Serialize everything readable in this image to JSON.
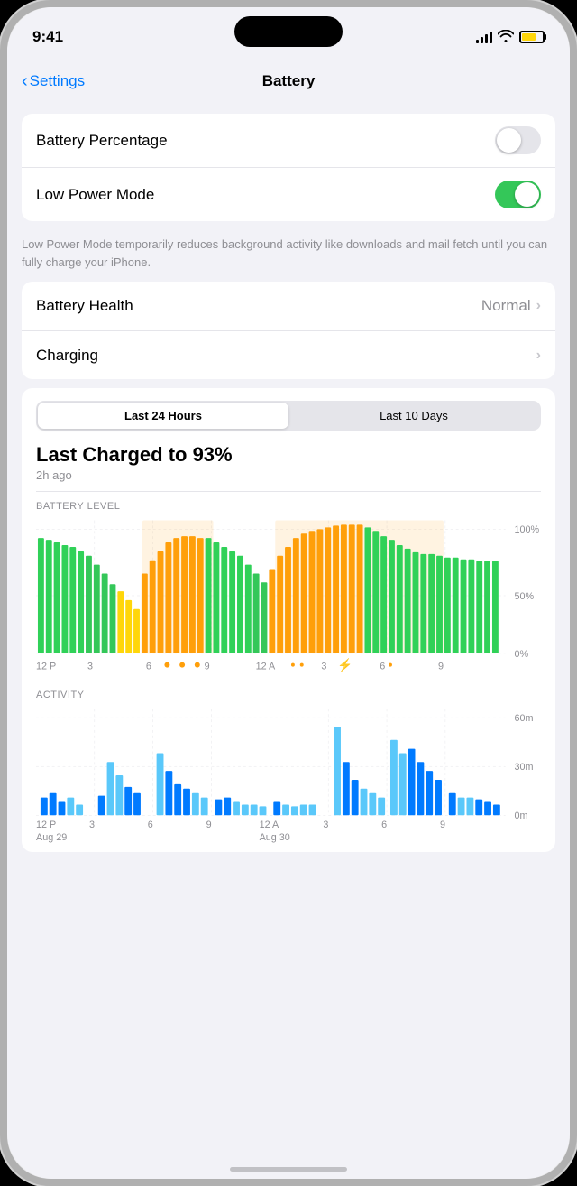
{
  "statusBar": {
    "time": "9:41",
    "batteryColor": "#ffd60a"
  },
  "nav": {
    "backLabel": "Settings",
    "title": "Battery"
  },
  "settings": {
    "batteryPercentageLabel": "Battery Percentage",
    "batteryPercentageOn": false,
    "lowPowerModeLabel": "Low Power Mode",
    "lowPowerModeOn": true,
    "lowPowerDescription": "Low Power Mode temporarily reduces background activity like downloads and mail fetch until you can fully charge your iPhone.",
    "batteryHealthLabel": "Battery Health",
    "batteryHealthValue": "Normal",
    "chargingLabel": "Charging"
  },
  "chart": {
    "segment1": "Last 24 Hours",
    "segment2": "Last 10 Days",
    "chargedTitle": "Last Charged to 93%",
    "chargedSub": "2h ago",
    "batteryLevelLabel": "BATTERY LEVEL",
    "activityLabel": "ACTIVITY",
    "yLabels": [
      "100%",
      "50%",
      "0%"
    ],
    "activityYLabels": [
      "60m",
      "30m",
      "0m"
    ],
    "xLabels": [
      "12 P",
      "3",
      "6",
      "9",
      "12 A",
      "3",
      "6",
      "9"
    ],
    "dateLabels": [
      "Aug 29",
      "",
      "",
      "",
      "Aug 30",
      "",
      "",
      ""
    ]
  }
}
